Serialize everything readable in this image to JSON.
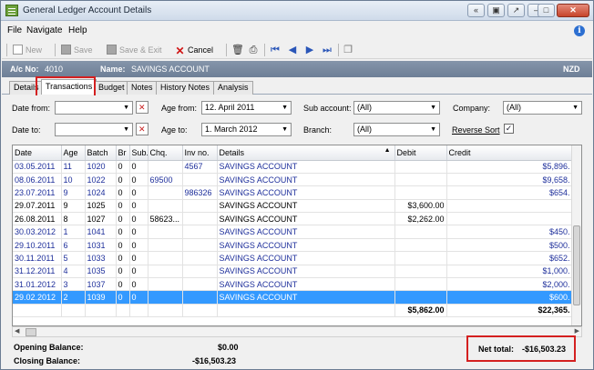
{
  "window": {
    "title": "General Ledger Account Details",
    "controls": [
      "«",
      "▣",
      "↗",
      "–",
      "□",
      "✕"
    ]
  },
  "menu": {
    "items": [
      "File",
      "Navigate",
      "Help"
    ]
  },
  "toolbar": {
    "new": "New",
    "save": "Save",
    "save_exit": "Save & Exit",
    "cancel": "Cancel"
  },
  "account": {
    "no_label": "A/c No:",
    "no_value": "4010",
    "name_label": "Name:",
    "name_value": "SAVINGS ACCOUNT",
    "currency": "NZD"
  },
  "tabs": [
    "Details",
    "Transactions",
    "Budget",
    "Notes",
    "History Notes",
    "Analysis"
  ],
  "filters": {
    "date_from_label": "Date from:",
    "date_from": "",
    "date_to_label": "Date to:",
    "date_to": "",
    "age_from_label": "Age from:",
    "age_from": "12. April 2011",
    "age_to_label": "Age to:",
    "age_to": "1. March 2012",
    "sub_account_label": "Sub account:",
    "sub_account": "(All)",
    "branch_label": "Branch:",
    "branch": "(All)",
    "company_label": "Company:",
    "company": "(All)",
    "reverse_sort_label": "Reverse Sort",
    "reverse_sort_checked": true
  },
  "grid": {
    "columns": [
      "Date",
      "Age",
      "Batch",
      "Br",
      "Sub.",
      "Chq.",
      "Inv no.",
      "Details",
      "Debit",
      "Credit"
    ],
    "rows": [
      [
        "03.05.2011",
        "11",
        "1020",
        "0",
        "0",
        "",
        "4567",
        "SAVINGS ACCOUNT",
        "",
        "$5,896."
      ],
      [
        "08.06.2011",
        "10",
        "1022",
        "0",
        "0",
        "69500",
        "",
        "SAVINGS ACCOUNT",
        "",
        "$9,658."
      ],
      [
        "23.07.2011",
        "9",
        "1024",
        "0",
        "0",
        "",
        "986326",
        "SAVINGS ACCOUNT",
        "",
        "$654."
      ],
      [
        "29.07.2011",
        "9",
        "1025",
        "0",
        "0",
        "",
        "",
        "SAVINGS ACCOUNT",
        "$3,600.00",
        ""
      ],
      [
        "26.08.2011",
        "8",
        "1027",
        "0",
        "0",
        "58623...",
        "",
        "SAVINGS ACCOUNT",
        "$2,262.00",
        ""
      ],
      [
        "30.03.2012",
        "1",
        "1041",
        "0",
        "0",
        "",
        "",
        "SAVINGS ACCOUNT",
        "",
        "$450."
      ],
      [
        "29.10.2011",
        "6",
        "1031",
        "0",
        "0",
        "",
        "",
        "SAVINGS ACCOUNT",
        "",
        "$500."
      ],
      [
        "30.11.2011",
        "5",
        "1033",
        "0",
        "0",
        "",
        "",
        "SAVINGS ACCOUNT",
        "",
        "$652."
      ],
      [
        "31.12.2011",
        "4",
        "1035",
        "0",
        "0",
        "",
        "",
        "SAVINGS ACCOUNT",
        "",
        "$1,000."
      ],
      [
        "31.01.2012",
        "3",
        "1037",
        "0",
        "0",
        "",
        "",
        "SAVINGS ACCOUNT",
        "",
        "$2,000."
      ],
      [
        "29.02.2012",
        "2",
        "1039",
        "0",
        "0",
        "",
        "",
        "SAVINGS ACCOUNT",
        "",
        "$600."
      ]
    ],
    "blue_rows": [
      0,
      1,
      2,
      5,
      6,
      7,
      8,
      9
    ],
    "selected_row": 10,
    "totals": {
      "debit": "$5,862.00",
      "credit": "$22,365."
    }
  },
  "footer": {
    "opening_label": "Opening Balance:",
    "opening_value": "$0.00",
    "closing_label": "Closing Balance:",
    "closing_value": "-$16,503.23",
    "net_total_label": "Net total:",
    "net_total_value": "-$16,503.23"
  },
  "colors": {
    "selection": "#3399ff",
    "highlight": "#d42020",
    "header_bar": "#7a8aa0",
    "link_text": "#1e2f9b"
  }
}
